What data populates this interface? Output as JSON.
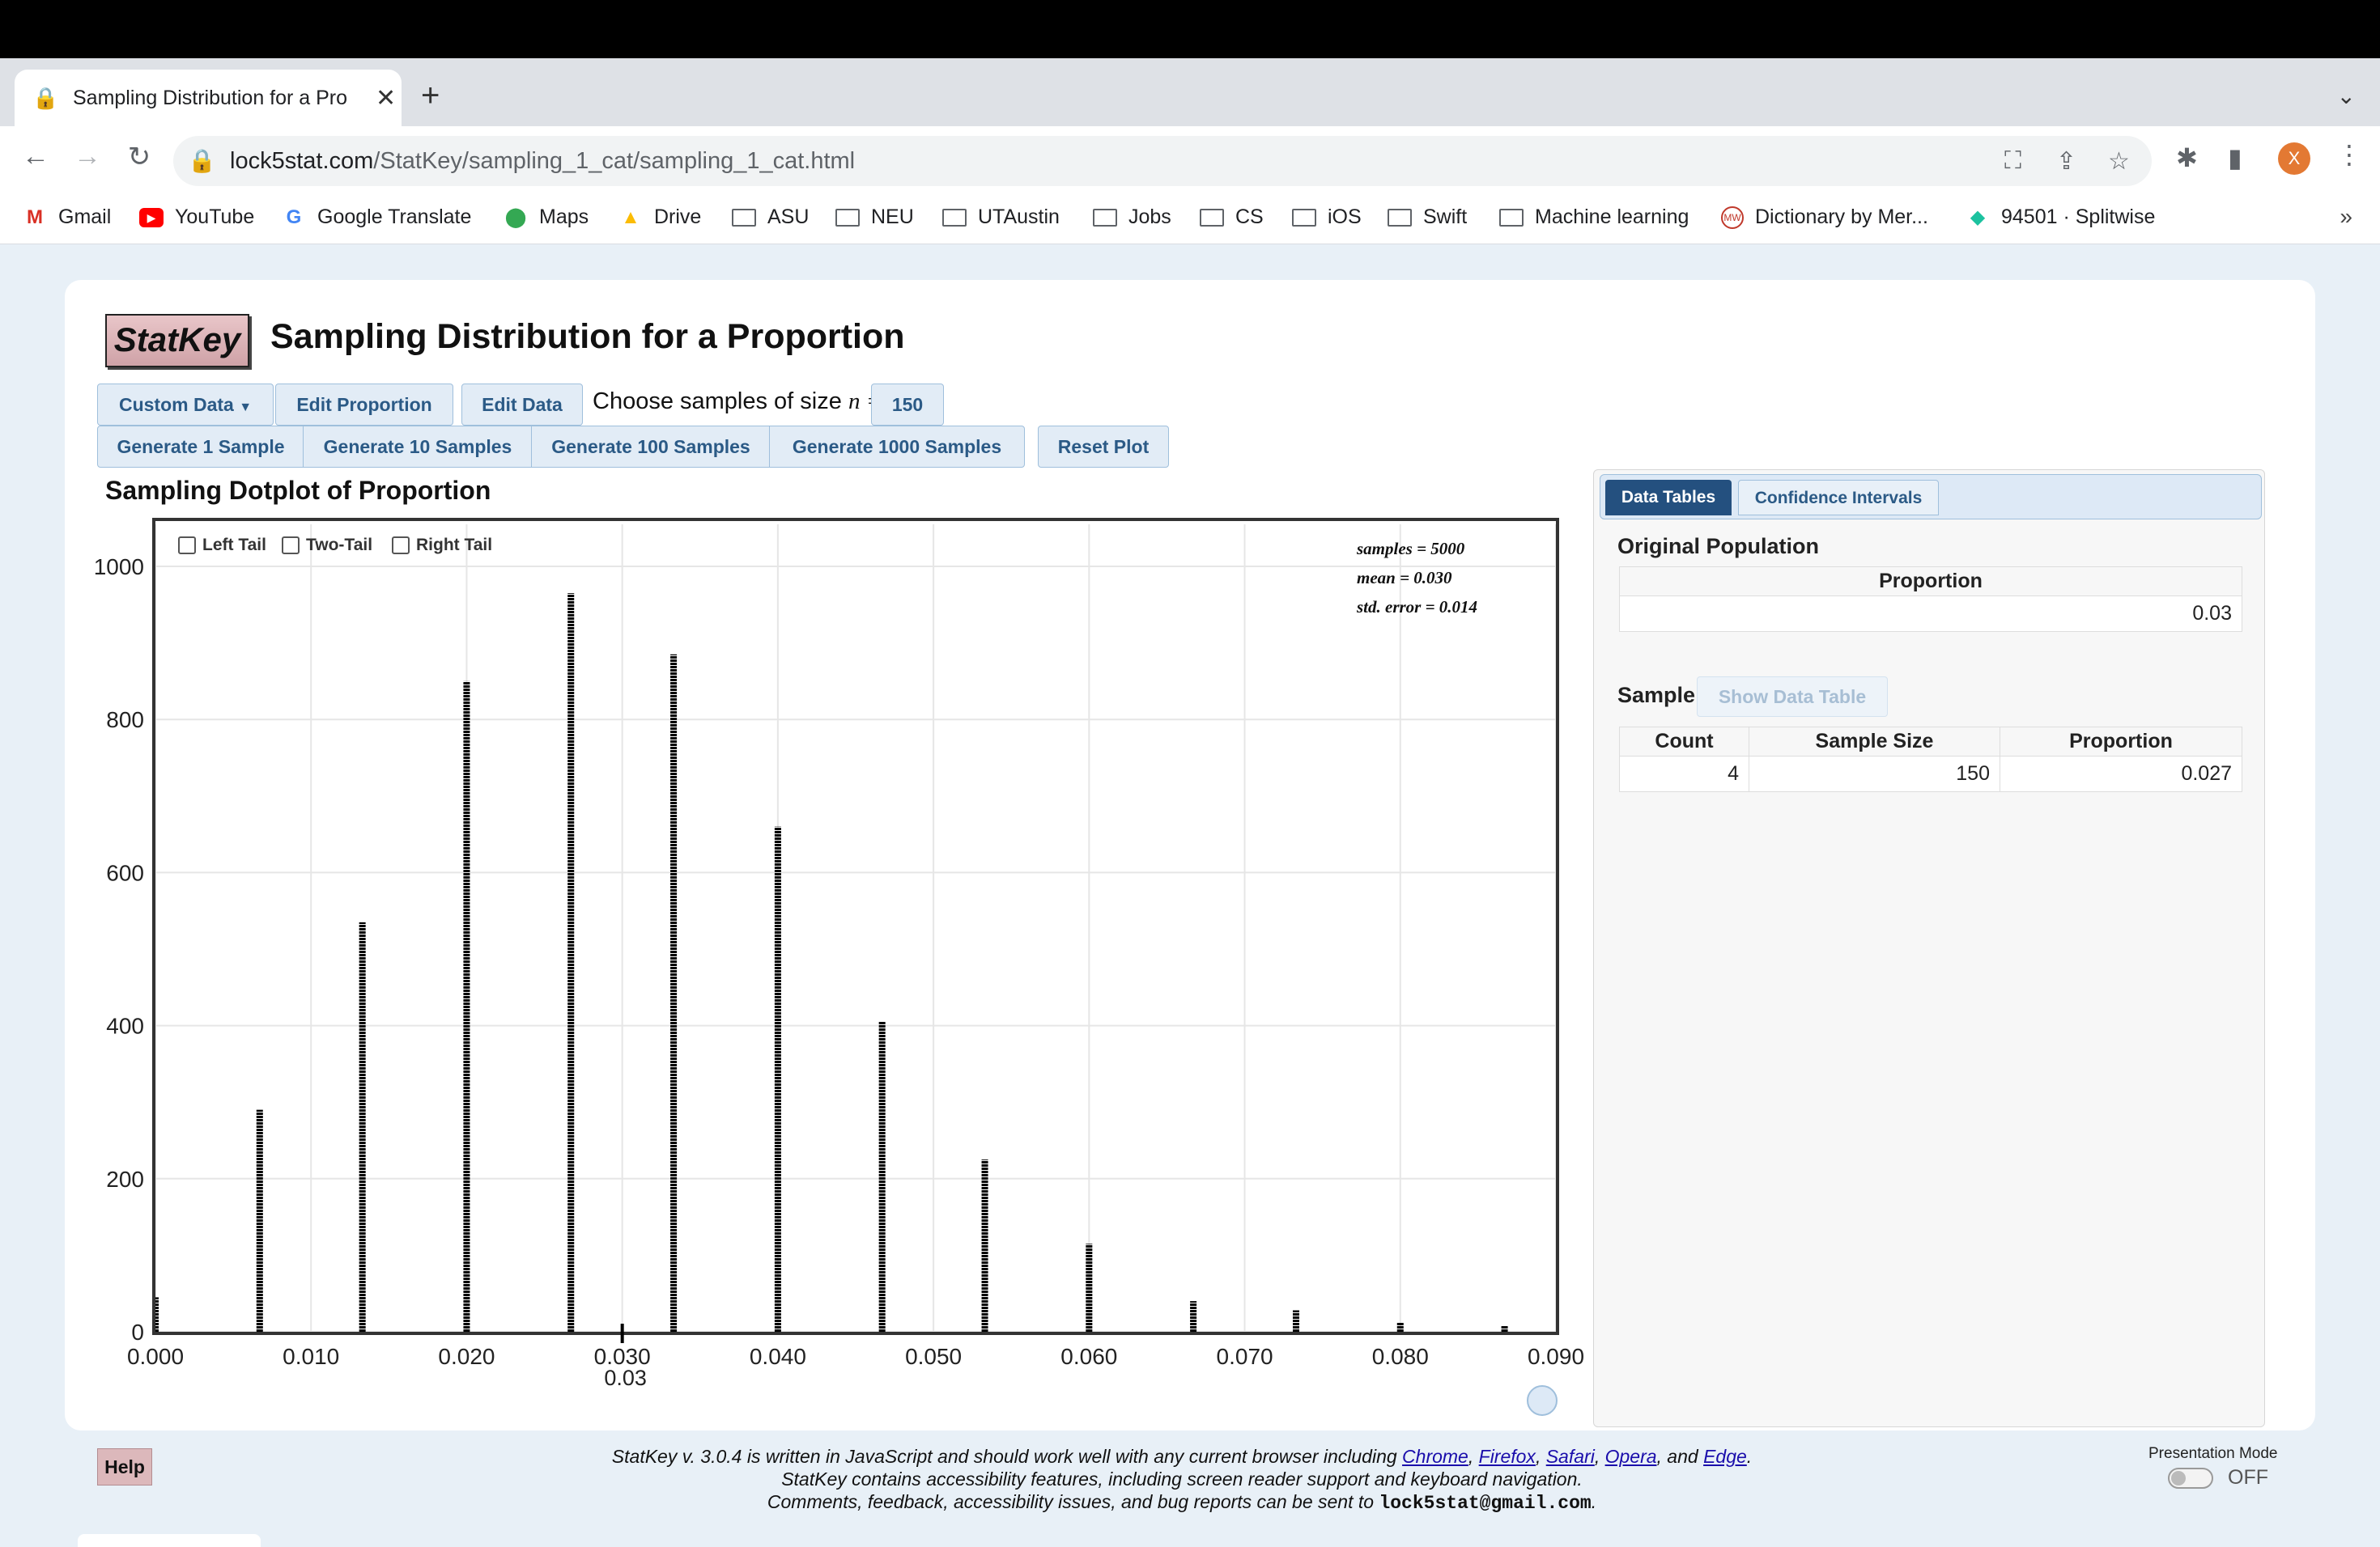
{
  "browser": {
    "tab_title": "Sampling Distribution for a Pro",
    "url_host": "lock5stat.com",
    "url_path": "/StatKey/sampling_1_cat/sampling_1_cat.html",
    "profile_initial": "X",
    "bookmarks": [
      "Gmail",
      "YouTube",
      "Google Translate",
      "Maps",
      "Drive",
      "ASU",
      "NEU",
      "UTAustin",
      "Jobs",
      "CS",
      "iOS",
      "Swift",
      "Machine learning",
      "Dictionary by Mer...",
      "94501 · Splitwise"
    ],
    "bookmarks_more": "»"
  },
  "header": {
    "logo": "StatKey",
    "title": "Sampling Distribution for a Proportion"
  },
  "controls": {
    "custom_data": "Custom Data",
    "edit_proportion": "Edit Proportion",
    "edit_data": "Edit Data",
    "choose_label": "Choose samples of size",
    "n_symbol": "n =",
    "n_value": "150",
    "gen1": "Generate 1 Sample",
    "gen10": "Generate 10 Samples",
    "gen100": "Generate 100 Samples",
    "gen1000": "Generate 1000 Samples",
    "reset": "Reset Plot"
  },
  "plot": {
    "title": "Sampling Dotplot of Proportion",
    "left_tail": "Left Tail",
    "two_tail": "Two-Tail",
    "right_tail": "Right Tail",
    "stat_samples": "samples = 5000",
    "stat_mean": "mean = 0.030",
    "stat_se": "std. error = 0.014",
    "marker_label": "0.03"
  },
  "chart_data": {
    "type": "bar",
    "title": "Sampling Dotplot of Proportion",
    "xlabel": "",
    "ylabel": "",
    "x": [
      0.0,
      0.0067,
      0.0133,
      0.02,
      0.0267,
      0.0333,
      0.04,
      0.0467,
      0.0533,
      0.06,
      0.0667,
      0.0733,
      0.08,
      0.0867
    ],
    "values": [
      45,
      290,
      535,
      850,
      965,
      885,
      660,
      405,
      225,
      115,
      40,
      28,
      12,
      8
    ],
    "xlim": [
      0.0,
      0.09
    ],
    "ylim": [
      0,
      1000
    ],
    "xticks": [
      "0.000",
      "0.010",
      "0.020",
      "0.030",
      "0.040",
      "0.050",
      "0.060",
      "0.070",
      "0.080",
      "0.090"
    ],
    "yticks": [
      "0",
      "200",
      "400",
      "600",
      "800",
      "1000"
    ],
    "marker_x": 0.03,
    "grid": true
  },
  "panel": {
    "tab_data": "Data Tables",
    "tab_ci": "Confidence Intervals",
    "orig_label": "Original Population",
    "orig_col": "Proportion",
    "orig_value": "0.03",
    "sample_label": "Sample",
    "show_table": "Show Data Table",
    "sample_cols": [
      "Count",
      "Sample Size",
      "Proportion"
    ],
    "sample_vals": [
      "4",
      "150",
      "0.027"
    ]
  },
  "footer": {
    "help": "Help",
    "line1_pre": "StatKey v. 3.0.4 is written in JavaScript and should work well with any current browser including ",
    "chrome": "Chrome",
    "firefox": "Firefox",
    "safari": "Safari",
    "opera": "Opera",
    "and": ", and ",
    "edge": "Edge",
    "line2": "StatKey contains accessibility features, including screen reader support and keyboard navigation.",
    "line3_pre": "Comments, feedback, accessibility issues, and bug reports can be sent to ",
    "email": "lock5stat@gmail.com",
    "presentation_mode": "Presentation Mode",
    "toggle_state": "OFF"
  }
}
